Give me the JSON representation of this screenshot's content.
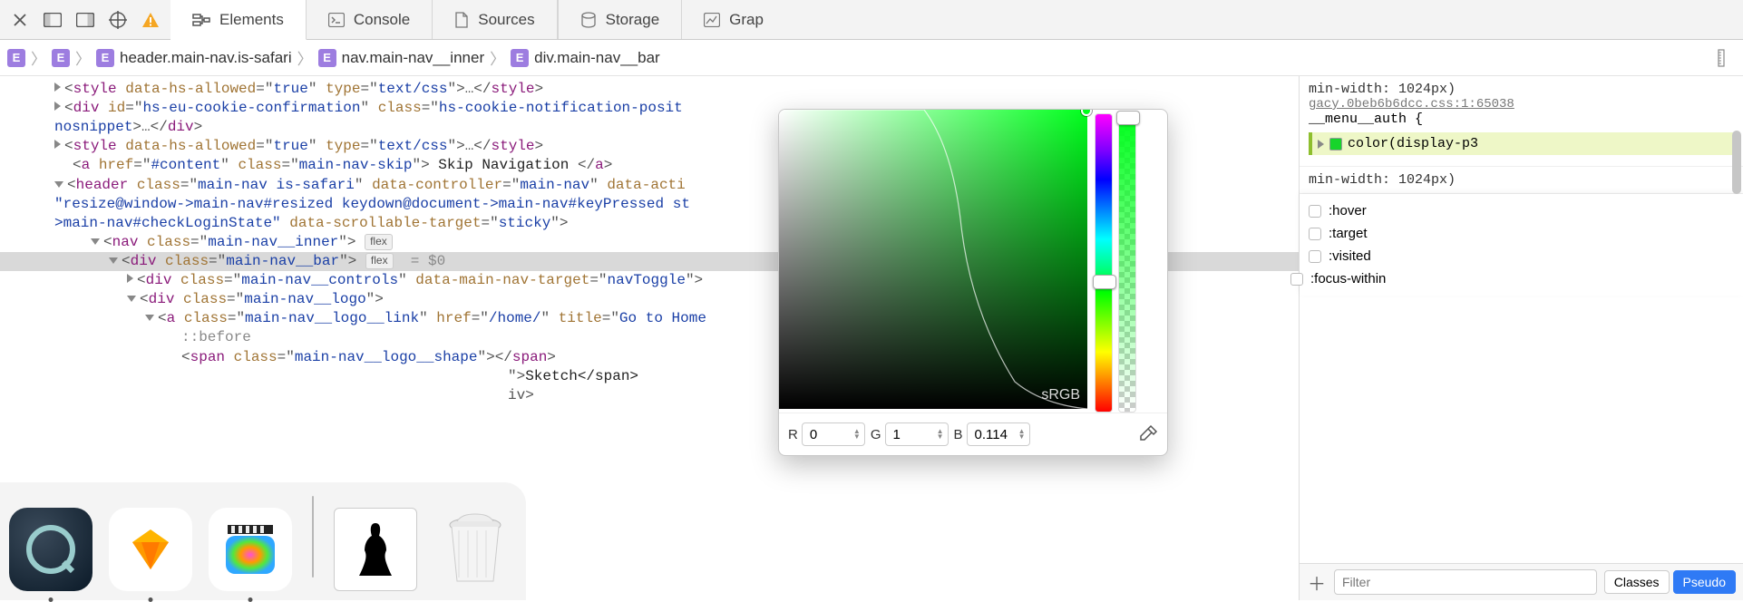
{
  "toolbar": {
    "tabs": [
      {
        "id": "elements",
        "label": "Elements",
        "active": true
      },
      {
        "id": "console",
        "label": "Console",
        "active": false
      },
      {
        "id": "sources",
        "label": "Sources",
        "active": false
      },
      {
        "id": "storage",
        "label": "Storage",
        "active": false
      },
      {
        "id": "graphics",
        "label": "Grap",
        "active": false
      }
    ]
  },
  "breadcrumbs": [
    {
      "badge": "E",
      "label": ""
    },
    {
      "badge": "E",
      "label": ""
    },
    {
      "badge": "E",
      "label": "header.main-nav.is-safari"
    },
    {
      "badge": "E",
      "label": "nav.main-nav__inner"
    },
    {
      "badge": "E",
      "label": "div.main-nav__bar"
    }
  ],
  "dom": {
    "flex_pill": "flex",
    "eq0": "= $0",
    "lines": {
      "style1_tag": "style",
      "style1_a1n": "data-hs-allowed",
      "style1_a1v": "true",
      "style1_a2n": "type",
      "style1_a2v": "text/css",
      "cookie_tag": "div",
      "cookie_a1n": "id",
      "cookie_a1v": "hs-eu-cookie-confirmation",
      "cookie_a2n": "class",
      "cookie_a2v": "hs-cookie-notification-posit",
      "cookie_trail": "nosnippet",
      "skip_tag": "a",
      "skip_hrefn": "href",
      "skip_hrefv": "#content",
      "skip_clsn": "class",
      "skip_clsv": "main-nav-skip",
      "skip_text": " Skip Navigation ",
      "header_tag": "header",
      "header_clsv": "main-nav is-safari",
      "header_dcn": "data-controller",
      "header_dcv": "main-nav",
      "header_dan": "data-acti",
      "header_wrap1": "\"resize@window->main-nav#resized keydown@document->main-nav#keyPressed st",
      "header_wrap2_pre": ">main-nav#checkLoginState\" ",
      "header_wrap2_an": "data-scrollable-target",
      "header_wrap2_av": "sticky",
      "nav_tag": "nav",
      "nav_clsv": "main-nav__inner",
      "bar_tag": "div",
      "bar_clsv": "main-nav__bar",
      "controls_tag": "div",
      "controls_clsv": "main-nav__controls",
      "controls_a2n": "data-main-nav-target",
      "controls_a2v": "navToggle",
      "logo_tag": "div",
      "logo_clsv": "main-nav__logo",
      "logolink_tag": "a",
      "logolink_clsv": "main-nav__logo__link",
      "logolink_hrefv": "/home/",
      "logolink_titlen": "title",
      "logolink_titlev": "Go to Home",
      "before": "::before",
      "span1_tag": "span",
      "span1_clsv": "main-nav__logo__shape",
      "span2_trail": "Sketch</span>",
      "close_iv": "iv>"
    }
  },
  "styles": {
    "rule1": {
      "media": "min-width: 1024px)",
      "source": "gacy.0beb6b6dcc.css:1:65038",
      "selector": "__menu__auth {",
      "swatch": "#17d42b",
      "decl": "color(display-p3"
    },
    "rule2": {
      "media": "min-width: 1024px)"
    },
    "pseudo": [
      ":hover",
      ":target",
      ":visited",
      ":focus-within"
    ],
    "filter_placeholder": "Filter",
    "btn_classes": "Classes",
    "btn_pseudo": "Pseudo"
  },
  "picker": {
    "gamut_label": "sRGB",
    "r_label": "R",
    "r_value": "0",
    "g_label": "G",
    "g_value": "1",
    "b_label": "B",
    "b_value": "0.114"
  },
  "dock": {
    "apps": [
      "quicktime",
      "sketch",
      "final-cut",
      "clipboard-gecko",
      "trash"
    ]
  }
}
